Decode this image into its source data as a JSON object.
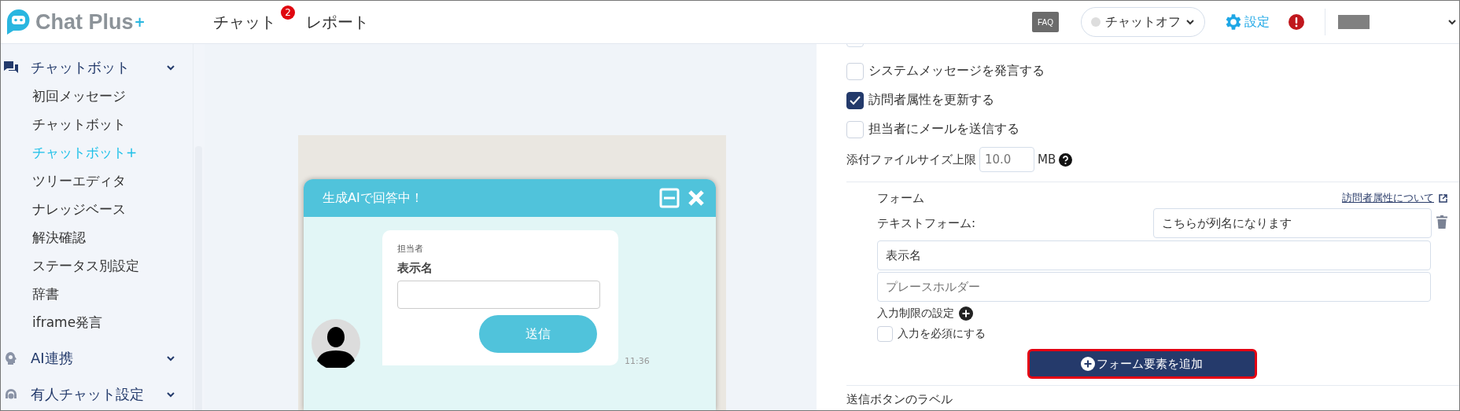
{
  "header": {
    "logo": {
      "text": "Chat Plus",
      "mark": "+"
    },
    "nav": [
      {
        "label": "チャット",
        "badge": "2"
      },
      {
        "label": "レポート"
      }
    ],
    "faq": "FAQ",
    "status": {
      "label": "チャットオフ",
      "online": false
    },
    "settings": "設定"
  },
  "sidebar": {
    "groups": [
      {
        "label": "チャットボット",
        "items": [
          {
            "label": "初回メッセージ",
            "selected": false
          },
          {
            "label": "チャットボット",
            "selected": false
          },
          {
            "label": "チャットボット+",
            "selected": true
          },
          {
            "label": "ツリーエディタ",
            "selected": false
          },
          {
            "label": "ナレッジベース",
            "selected": false
          },
          {
            "label": "解決確認",
            "selected": false
          },
          {
            "label": "ステータス別設定",
            "selected": false
          },
          {
            "label": "辞書",
            "selected": false
          },
          {
            "label": "iframe発言",
            "selected": false
          }
        ]
      },
      {
        "label": "AI連携"
      },
      {
        "label": "有人チャット設定"
      }
    ]
  },
  "preview": {
    "title": "生成AIで回答中！",
    "message": {
      "sender": "担当者",
      "field_label": "表示名",
      "button": "送信",
      "time": "11:36"
    }
  },
  "settings": {
    "checkboxes": [
      {
        "label": "システムメッセージを発言する",
        "checked": false
      },
      {
        "label": "訪問者属性を更新する",
        "checked": true
      },
      {
        "label": "担当者にメールを送信する",
        "checked": false
      }
    ],
    "attachment": {
      "label": "添付ファイルサイズ上限",
      "placeholder": "10.0",
      "unit": "MB"
    },
    "form": {
      "title": "フォーム",
      "link": "訪問者属性について",
      "elements": [
        {
          "label": "テキストフォーム:",
          "column_name": "こちらが列名になります",
          "display_name": "表示名",
          "placeholder": "プレースホルダー",
          "restriction_label": "入力制限の設定",
          "required": {
            "label": "入力を必須にする",
            "checked": false
          }
        }
      ],
      "add_button": "フォーム要素を追加"
    },
    "submit_label": "送信ボタンのラベル"
  }
}
